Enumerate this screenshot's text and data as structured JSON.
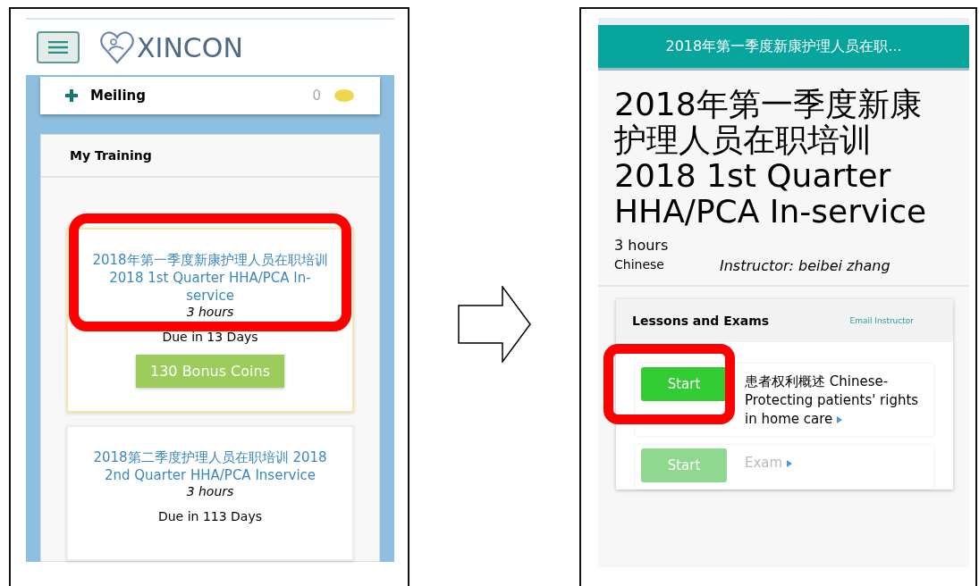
{
  "left_screen": {
    "logo": "XINCON",
    "user": {
      "name": "Meiling",
      "coins": "0"
    },
    "panel_title": "My Training",
    "courses": [
      {
        "title": "2018年第一季度新康护理人员在职培训 2018 1st Quarter HHA/PCA In-service",
        "hours": "3 hours",
        "due": "Due in 13 Days",
        "bonus": "130 Bonus Coins",
        "urgent": true,
        "annotated": true
      },
      {
        "title": "2018第二季度护理人员在职培训 2018 2nd Quarter HHA/PCA Inservice",
        "hours": "3 hours",
        "due": "Due in 113 Days",
        "urgent": false,
        "annotated": false
      }
    ]
  },
  "right_screen": {
    "header": "2018年第一季度新康护理人员在职...",
    "title": "2018年第一季度新康护理人员在职培训 2018 1st Quarter HHA/PCA In-service",
    "hours": "3 hours",
    "language": "Chinese",
    "instructor": "Instructor: beibei zhang",
    "panel_title": "Lessons and Exams",
    "email_link": "Email Instructor",
    "lessons": [
      {
        "button": "Start",
        "title": "患者权利概述 Chinese-Protecting patients' rights in home care",
        "disabled": false,
        "annotated": true
      },
      {
        "button": "Start",
        "title": "Exam",
        "disabled": true,
        "annotated": false
      }
    ]
  }
}
